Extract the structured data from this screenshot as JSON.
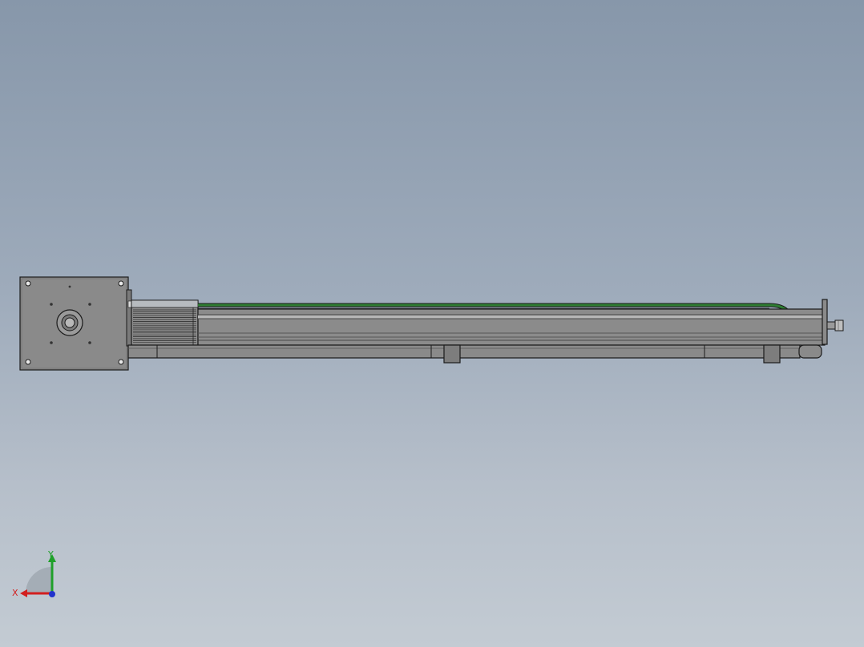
{
  "viewport": {
    "background_top": "#8797aa",
    "background_bottom": "#c3cbd3"
  },
  "model": {
    "part_color": "#8a8a8a",
    "part_dark": "#5e5e5e",
    "edge_color": "#1a1a1a",
    "cable_color": "#2e7d32"
  },
  "triad": {
    "x_label": "X",
    "y_label": "Y",
    "x_color": "#d21f1f",
    "y_color": "#1fa02a",
    "z_color": "#2233cc"
  }
}
